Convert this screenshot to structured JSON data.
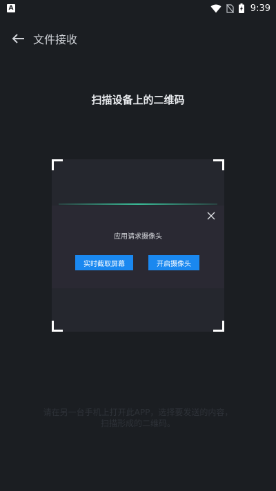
{
  "status_bar": {
    "notification_glyph": "A",
    "time": "9:39",
    "icons": [
      "wifi-icon",
      "no-sim-icon",
      "battery-charging-icon"
    ]
  },
  "header": {
    "title": "文件接收",
    "back_icon": "arrow-left-icon"
  },
  "scan": {
    "heading": "扫描设备上的二维码"
  },
  "dialog": {
    "message": "应用请求摄像头",
    "capture_screen_label": "实时截取屏幕",
    "open_camera_label": "开启摄像头",
    "close_icon": "close-icon"
  },
  "hint": {
    "text": "请在另一台手机上打开此APP，选择要发送的内容，扫描形成的二维码。"
  },
  "colors": {
    "background": "#1b1e22",
    "scanner_bg": "#25272e",
    "dialog_bg": "#2a2933",
    "button_blue": "#1a88f0",
    "scan_line": "#3bbf9a"
  }
}
